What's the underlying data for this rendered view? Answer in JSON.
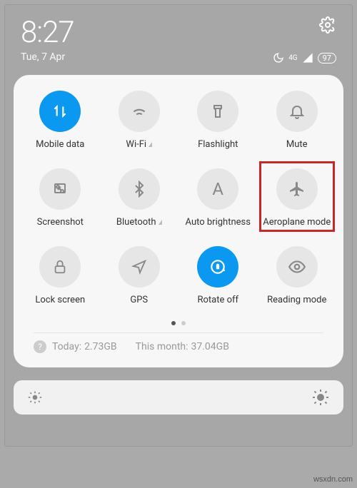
{
  "status": {
    "time": "8:27",
    "date": "Tue, 7 Apr",
    "network_label": "4G",
    "battery": "97"
  },
  "tiles": [
    {
      "id": "mobile-data",
      "label": "Mobile data",
      "active": true
    },
    {
      "id": "wifi",
      "label": "Wi-Fi",
      "active": false,
      "arrow": true
    },
    {
      "id": "flashlight",
      "label": "Flashlight",
      "active": false
    },
    {
      "id": "mute",
      "label": "Mute",
      "active": false
    },
    {
      "id": "screenshot",
      "label": "Screenshot",
      "active": false
    },
    {
      "id": "bluetooth",
      "label": "Bluetooth",
      "active": false,
      "arrow": true
    },
    {
      "id": "auto-brightness",
      "label": "Auto brightness",
      "active": false
    },
    {
      "id": "aeroplane-mode",
      "label": "Aeroplane mode",
      "active": false,
      "highlighted": true
    },
    {
      "id": "lock-screen",
      "label": "Lock screen",
      "active": false
    },
    {
      "id": "gps",
      "label": "GPS",
      "active": false
    },
    {
      "id": "rotate-off",
      "label": "Rotate off",
      "active": true
    },
    {
      "id": "reading-mode",
      "label": "Reading mode",
      "active": false
    }
  ],
  "usage": {
    "today_label": "Today:",
    "today_value": "2.73GB",
    "month_label": "This month:",
    "month_value": "37.04GB"
  },
  "watermark": "wsxdn.com"
}
